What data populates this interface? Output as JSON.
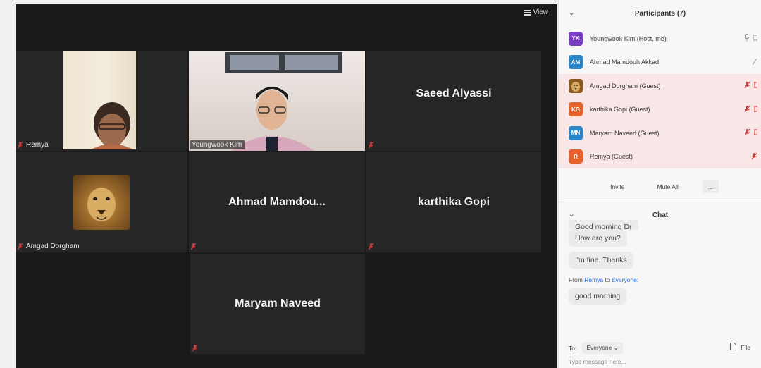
{
  "gallery": {
    "view_label": "View",
    "tiles": [
      {
        "name": "Remya"
      },
      {
        "name": "Youngwook Kim"
      },
      {
        "name": "Saeed Alyassi"
      },
      {
        "name": "Amgad Dorgham"
      },
      {
        "name": "Ahmad Mamdou..."
      },
      {
        "name": "karthika Gopi"
      },
      {
        "name": "Maryam Naveed"
      }
    ]
  },
  "participants": {
    "title": "Participants (7)",
    "items": [
      {
        "initials": "YK",
        "name": "Youngwook Kim (Host, me)",
        "color": "#7b3fc4"
      },
      {
        "initials": "AM",
        "name": "Ahmad Mamdouh Akkad",
        "color": "#2a86c7"
      },
      {
        "initials": "",
        "name": "Amgad Dorgham (Guest)",
        "color": "#a7742f"
      },
      {
        "initials": "KG",
        "name": "karthika Gopi (Guest)",
        "color": "#e5622a"
      },
      {
        "initials": "MN",
        "name": "Maryam Naveed (Guest)",
        "color": "#2a86c7"
      },
      {
        "initials": "R",
        "name": "Remya (Guest)",
        "color": "#e5622a"
      }
    ],
    "invite_label": "Invite",
    "mute_all_label": "Mute All",
    "more_label": "..."
  },
  "chat": {
    "title": "Chat",
    "messages": [
      "Good morning Dr",
      "How are you?",
      "I'm fine. Thanks"
    ],
    "from_prefix": "From",
    "from_sender": "Remya",
    "from_to": "to",
    "from_recipient": "Everyone:",
    "last_message": "good morning",
    "to_label": "To:",
    "to_value": "Everyone",
    "file_label": "File",
    "input_placeholder": "Type message here..."
  },
  "colors": {
    "active_speaker": "#c9d948",
    "muted_mic": "#d23b3b",
    "link": "#2d6fd6"
  }
}
